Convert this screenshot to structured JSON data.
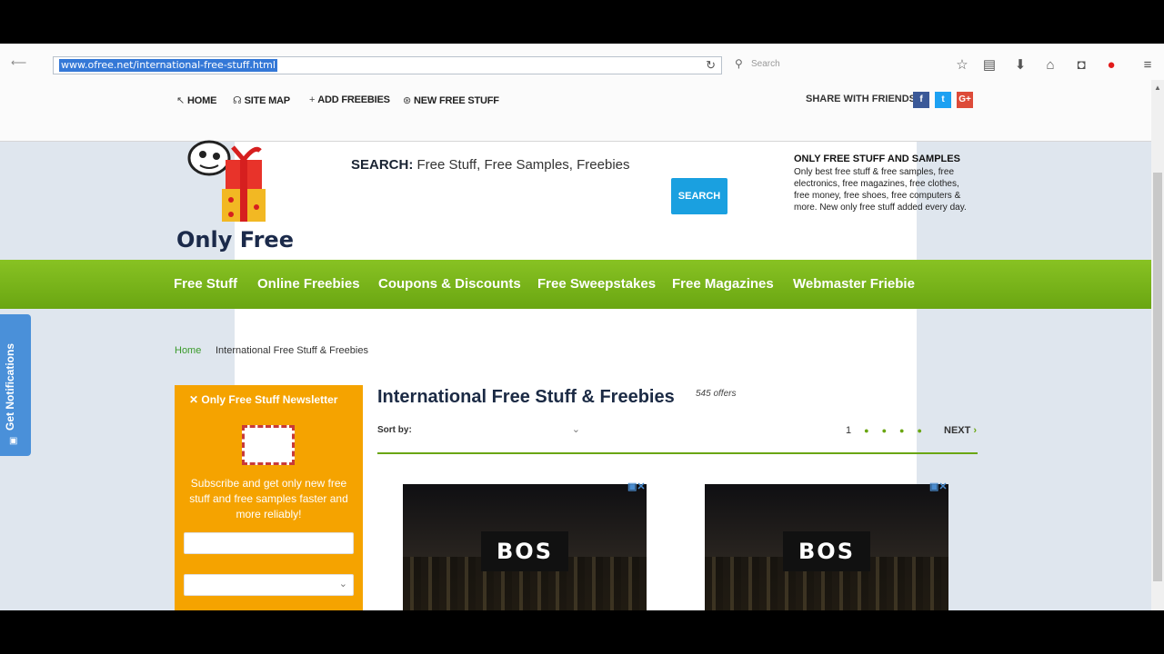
{
  "browser": {
    "url": "www.ofree.net/international-free-stuff.html",
    "search_placeholder": "Search"
  },
  "site_nav": {
    "home": "HOME",
    "site_map": "SITE MAP",
    "add_freebies": "ADD FREEBIES",
    "new_free_stuff": "NEW FREE STUFF",
    "share_label": "SHARE WITH FRIENDS",
    "social": {
      "facebook": "f",
      "twitter": "t",
      "google_plus": "G+"
    }
  },
  "header": {
    "logo_text": "Only Free",
    "search_prefix": "SEARCH:",
    "search_text": "Free Stuff, Free Samples, Freebies",
    "search_button": "SEARCH",
    "promo_title": "ONLY FREE STUFF AND SAMPLES",
    "promo_text": "Only best free stuff & free samples, free electronics, free magazines, free clothes, free money, free shoes, free computers & more. New only free stuff added every day."
  },
  "green_nav": [
    "Free Stuff",
    "Online Freebies",
    "Coupons & Discounts",
    "Free Sweepstakes",
    "Free Magazines",
    "Webmaster Friebie"
  ],
  "breadcrumb": {
    "home": "Home",
    "current": "International Free Stuff & Freebies"
  },
  "newsletter": {
    "title": "Only Free Stuff Newsletter",
    "text": "Subscribe and get only new free stuff and free samples faster and more reliably!"
  },
  "main": {
    "title": "International Free Stuff & Freebies",
    "offers": "545 offers",
    "sort_by": "Sort by:",
    "page_current": "1",
    "next": "NEXT"
  },
  "ads": [
    {
      "logo": "BOS"
    },
    {
      "logo": "BOS"
    }
  ],
  "side_tab": {
    "label": "Get Notifications"
  },
  "colors": {
    "green": "#6aa612",
    "orange": "#f5a300",
    "search_blue": "#1aa0e0"
  }
}
